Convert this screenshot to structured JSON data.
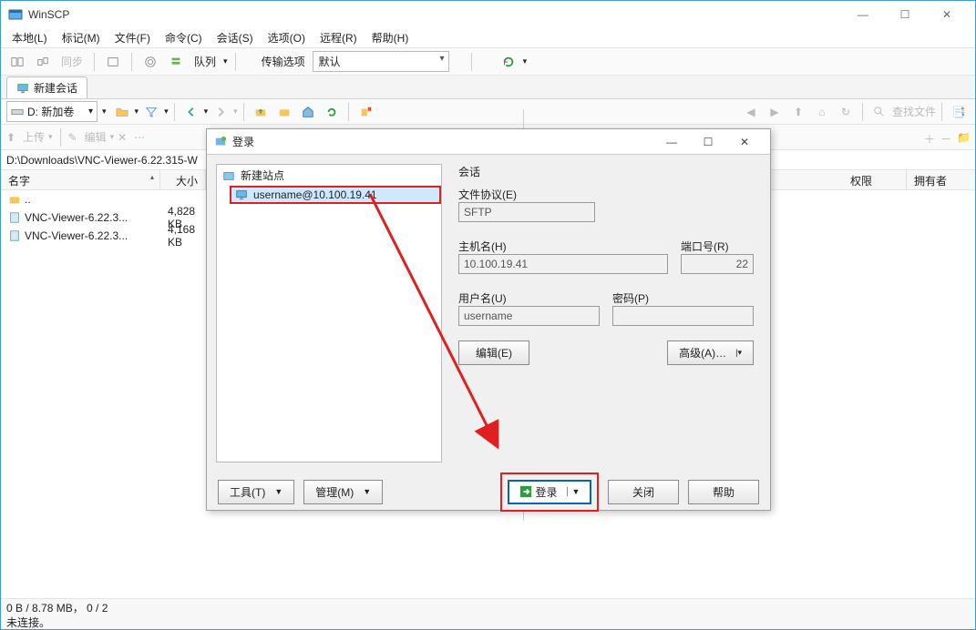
{
  "titlebar": {
    "title": "WinSCP"
  },
  "menubar": {
    "local": "本地(L)",
    "mark": "标记(M)",
    "file": "文件(F)",
    "command": "命令(C)",
    "session": "会话(S)",
    "options": "选项(O)",
    "remote": "远程(R)",
    "help": "帮助(H)"
  },
  "toolbar": {
    "sync_label": "同步",
    "queue_label": "队列",
    "transfer_opt_label": "传输选项",
    "transfer_default": "默认"
  },
  "session_tab": {
    "label": "新建会话"
  },
  "drive": {
    "label": "D: 新加卷"
  },
  "actions": {
    "upload": "上传",
    "edit": "编辑",
    "find": "查找文件"
  },
  "path": {
    "local": "D:\\Downloads\\VNC-Viewer-6.22.315-W"
  },
  "columns": {
    "name": "名字",
    "size": "大小",
    "perm": "权限",
    "owner": "拥有者"
  },
  "files": [
    {
      "name": "..",
      "size": ""
    },
    {
      "name": "VNC-Viewer-6.22.3...",
      "size": "4,828 KB"
    },
    {
      "name": "VNC-Viewer-6.22.3...",
      "size": "4,168 KB"
    }
  ],
  "status": {
    "line1": "0 B / 8.78 MB，  0 / 2",
    "line2": "未连接。"
  },
  "dialog": {
    "title": "登录",
    "tree": {
      "root": "新建站点",
      "item": "username@10.100.19.41"
    },
    "session_group": "会话",
    "protocol_label": "文件协议(E)",
    "protocol_value": "SFTP",
    "host_label": "主机名(H)",
    "host_value": "10.100.19.41",
    "port_label": "端口号(R)",
    "port_value": "22",
    "user_label": "用户名(U)",
    "user_value": "username",
    "password_label": "密码(P)",
    "edit_btn": "编辑(E)",
    "advanced_btn": "高级(A)…",
    "tools_btn": "工具(T)",
    "manage_btn": "管理(M)",
    "login_btn": "登录",
    "close_btn": "关闭",
    "help_btn": "帮助"
  }
}
